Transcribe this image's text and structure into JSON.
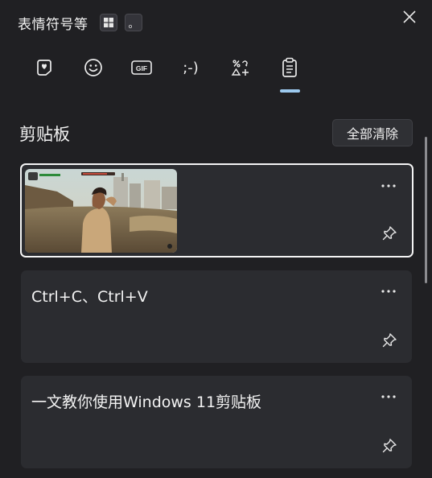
{
  "header": {
    "title": "表情符号等",
    "chip_dot": "。"
  },
  "tabs": [
    {
      "name": "favorites",
      "icon": "heart-note-icon"
    },
    {
      "name": "emoji",
      "icon": "smiley-icon"
    },
    {
      "name": "gif",
      "icon": "gif-icon",
      "label": "GIF"
    },
    {
      "name": "kaomoji",
      "icon": "kaomoji-icon",
      "label": ";-)"
    },
    {
      "name": "symbols",
      "icon": "symbols-icon"
    },
    {
      "name": "clipboard",
      "icon": "clipboard-icon",
      "selected": true
    }
  ],
  "clipboard": {
    "section_title": "剪贴板",
    "clear_all_label": "全部清除",
    "items": [
      {
        "type": "image",
        "description_icon": "game-screenshot-image",
        "selected": true
      },
      {
        "type": "text",
        "text": "Ctrl+C、Ctrl+V"
      },
      {
        "type": "text",
        "text": "一文教你使用Windows 11剪贴板"
      }
    ]
  },
  "colors": {
    "background": "#202023",
    "card": "#2b2c30",
    "accent": "#9cc9ee",
    "selected_border": "#f4f4f4"
  }
}
